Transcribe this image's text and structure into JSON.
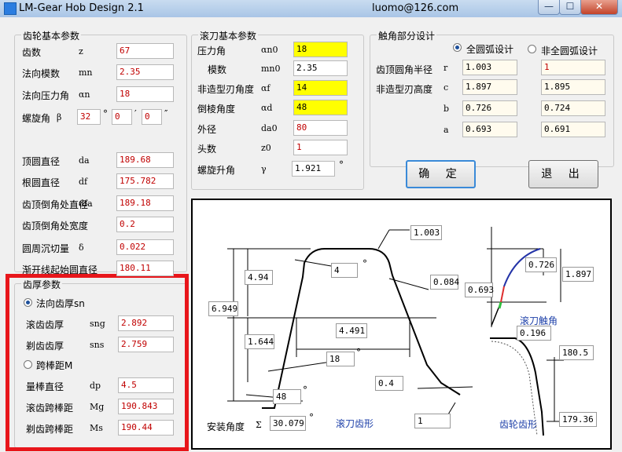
{
  "window": {
    "title": "LM-Gear Hob Design 2.1",
    "email": "luomo@126.com",
    "min_glyph": "—",
    "max_glyph": "☐",
    "close_glyph": "✕"
  },
  "gear_basic": {
    "title": "齿轮基本参数",
    "rows": [
      {
        "label": "齿数",
        "sym": "z",
        "value": "67"
      },
      {
        "label": "法向模数",
        "sym": "mn",
        "value": "2.35"
      },
      {
        "label": "法向压力角",
        "sym": "αn",
        "value": "18"
      },
      {
        "label": "顶圆直径",
        "sym": "da",
        "value": "189.68"
      },
      {
        "label": "根圆直径",
        "sym": "df",
        "value": "175.782"
      },
      {
        "label": "齿顶倒角处直径",
        "sym": "dfa",
        "value": "189.18"
      },
      {
        "label": "齿顶倒角处宽度",
        "sym": "",
        "value": "0.2"
      },
      {
        "label": "圆周沉切量",
        "sym": "δ",
        "value": "0.022"
      },
      {
        "label": "渐开线起始圆直径",
        "sym": "",
        "value": "180.11"
      }
    ],
    "helix": {
      "label": "螺旋角",
      "sym": "β",
      "deg": "32",
      "deg_unit": "°",
      "min": "0",
      "min_unit": "′",
      "sec": "0",
      "sec_unit": "″"
    }
  },
  "hob_basic": {
    "title": "滚刀基本参数",
    "rows": [
      {
        "label": "压力角",
        "sym": "αn0",
        "value": "18"
      },
      {
        "label": "模数",
        "sym": "mn0",
        "value": "2.35"
      },
      {
        "label": "非造型刃角度",
        "sym": "αf",
        "value": "14"
      },
      {
        "label": "倒棱角度",
        "sym": "αd",
        "value": "48"
      },
      {
        "label": "外径",
        "sym": "da0",
        "value": "80"
      },
      {
        "label": "头数",
        "sym": "z0",
        "value": "1"
      },
      {
        "label": "螺旋升角",
        "sym": "γ",
        "value": "1.921",
        "unit": "°"
      }
    ]
  },
  "tip_design": {
    "title": "触角部分设计",
    "opt_full": "全圆弧设计",
    "opt_nonfull": "非全圆弧设计",
    "radius_label": "齿顶圆角半径",
    "height_label": "非造型刃高度",
    "rows": [
      {
        "sym": "r",
        "v1": "1.003",
        "v2": "1"
      },
      {
        "sym": "c",
        "v1": "1.897",
        "v2": "1.895"
      },
      {
        "sym": "b",
        "v1": "0.726",
        "v2": "0.724"
      },
      {
        "sym": "a",
        "v1": "0.693",
        "v2": "0.691"
      }
    ]
  },
  "buttons": {
    "ok": "确 定",
    "exit": "退 出"
  },
  "thickness": {
    "title": "齿厚参数",
    "opt_sn": "法向齿厚sn",
    "opt_m": "跨棒距M",
    "rows1": [
      {
        "label": "滚齿齿厚",
        "sym": "sng",
        "value": "2.892"
      },
      {
        "label": "剃齿齿厚",
        "sym": "sns",
        "value": "2.759"
      }
    ],
    "rows2": [
      {
        "label": "量棒直径",
        "sym": "dp",
        "value": "4.5"
      },
      {
        "label": "滚齿跨棒距",
        "sym": "Mg",
        "value": "190.843"
      },
      {
        "label": "剃齿跨棒距",
        "sym": "Ms",
        "value": "190.44"
      }
    ]
  },
  "drawing": {
    "boxes": {
      "r": "1.003",
      "h_upper": "4.94",
      "angle4": "4",
      "deg": "°",
      "v0084": "0.084",
      "total": "6.949",
      "width": "4.491",
      "h_lower": "1.644",
      "angle18": "18",
      "v04": "0.4",
      "angle48": "48",
      "install": "30.079",
      "v1": "1",
      "b": "0.726",
      "a": "0.693",
      "c": "1.897",
      "v0196": "0.196",
      "d1805": "180.5",
      "d17936": "179.36"
    },
    "install_label": "安装角度",
    "install_sym": "Σ",
    "hob_profile_label": "滚刀齿形",
    "hob_tip_label": "滚刀触角",
    "gear_profile_label": "齿轮齿形"
  }
}
